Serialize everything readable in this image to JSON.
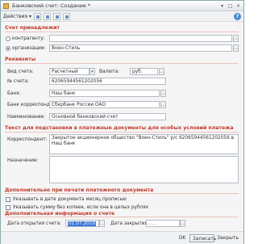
{
  "window": {
    "title": "Банковский счет: Создание *",
    "ctrl_more": "▾",
    "ctrl_max": "□",
    "ctrl_close": "×"
  },
  "toolbar": {
    "actions_label": "Действия ▾",
    "help": "?"
  },
  "owner": {
    "section": "Счет принадлежит",
    "opt_contractor": "контрагенту:",
    "opt_org": "организации:",
    "org_value": "Воен-Стиль"
  },
  "requisites": {
    "section": "Реквизиты",
    "type_label": "Вид счета:",
    "type_value": "Расчетный",
    "currency_label": "Валюта:",
    "currency_value": "руб.",
    "account_label": "№ счета:",
    "account_value": "62065944561202056",
    "bank_label": "Банк:",
    "bank_value": "Наш банк",
    "corr_label": "Банк корреспондент:",
    "corr_value": "Сбербанк России ОАО",
    "name_label": "Наименование:",
    "name_value": "Основной банковский счет"
  },
  "payment_text": {
    "section": "Текст для подстановки в платежные документы для особых условий платежа",
    "corr_label": "Корреспондент:",
    "corr_text": "Закрытое акционерное общество \"Воен-Стиль\" р/с 62065944561202056 в Наш банк",
    "purpose_label": "Назначение:",
    "purpose_text": ""
  },
  "extra_print": {
    "section": "Дополнительно при печати платежного документа",
    "chk1": "Указывать в дате документа месяц прописью",
    "chk2": "Указывать сумму без копеек, если она в целых рублях"
  },
  "extra_info": {
    "section": "Дополнительная информация о счете",
    "open_label": "Дата открытия счета:",
    "open_value": "01.07.2010",
    "close_label": "Дата закрытия:",
    "close_value": ". . ."
  },
  "footer": {
    "ok": "OK",
    "save": "Записать",
    "close": "Закрыть"
  }
}
